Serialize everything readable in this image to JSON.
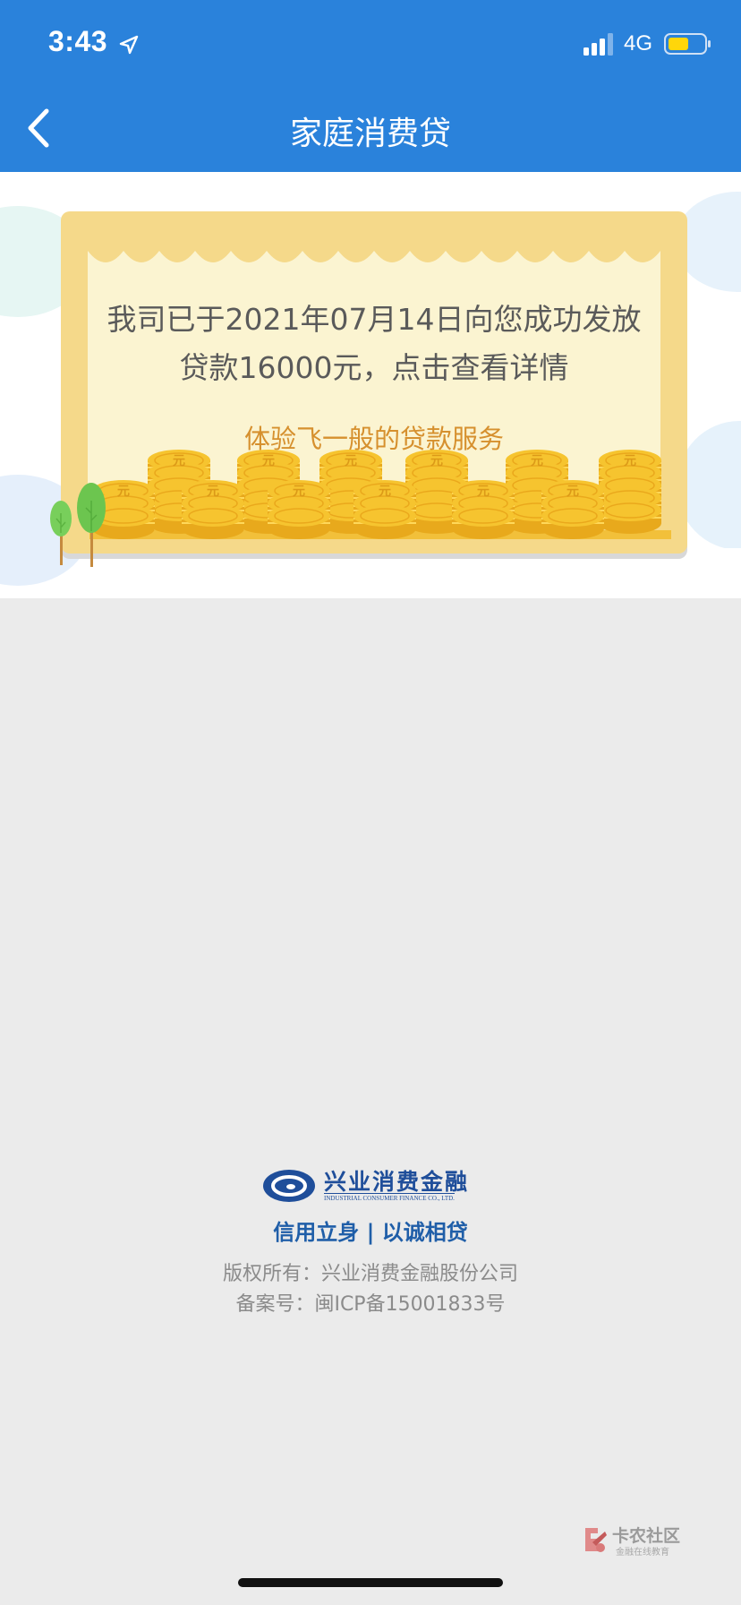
{
  "status_bar": {
    "time": "3:43",
    "network": "4G",
    "icons": [
      "location-arrow-icon",
      "signal-bars-icon",
      "battery-icon"
    ]
  },
  "nav": {
    "title": "家庭消费贷",
    "back_icon": "chevron-left-icon"
  },
  "banner": {
    "line1": "我司已于2021年07月14日向您成功发放",
    "line2": "贷款16000元，点击查看详情",
    "slogan": "体验飞一般的贷款服务",
    "coin_glyph": "元",
    "colors": {
      "card": "#f5d98a",
      "inner": "#fbf4d1",
      "slogan": "#d6902e",
      "coin": "#f6c42f"
    }
  },
  "footer": {
    "logo_cn": "兴业消费金融",
    "logo_en": "INDUSTRIAL CONSUMER FINANCE CO., LTD.",
    "slogan": "信用立身 | 以诚相贷",
    "copyright": "版权所有：兴业消费金融股份公司",
    "icp": "备案号：闽ICP备15001833号"
  },
  "watermark": {
    "title": "卡农社区",
    "subtitle": "金融在线教育"
  },
  "colors": {
    "header": "#2a82db",
    "page_bg": "#ebebeb",
    "brand_blue": "#1f4e9a"
  }
}
